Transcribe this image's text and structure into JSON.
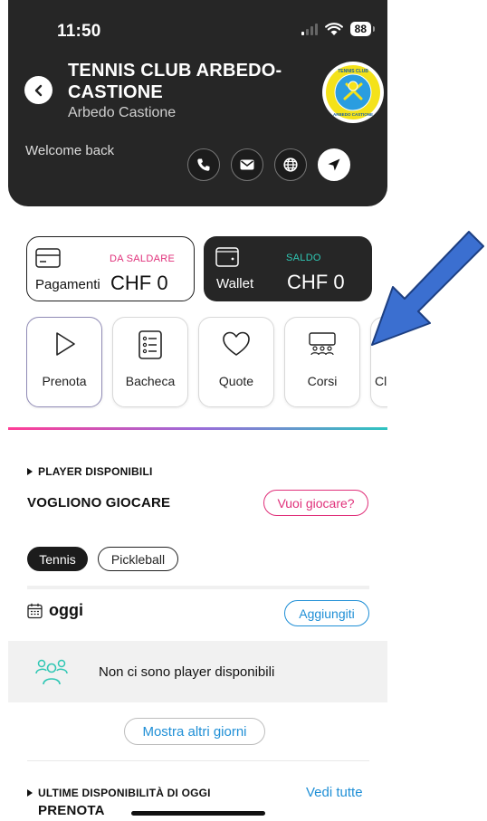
{
  "status_bar": {
    "time": "11:50",
    "battery": "88",
    "icons": [
      "signal-icon",
      "wifi-icon",
      "battery-icon"
    ]
  },
  "header": {
    "club_name": "TENNIS CLUB ARBEDO-CASTIONE",
    "club_city": "Arbedo Castione",
    "welcome": "Welcome back",
    "logo_text": "TENNIS CLUB ARBEDO CASTIONE",
    "contact_icons": [
      "phone-icon",
      "mail-icon",
      "globe-icon",
      "navigation-icon"
    ]
  },
  "payments": {
    "pay": {
      "tag": "DA SALDARE",
      "label": "Pagamenti",
      "amount": "CHF 0"
    },
    "wallet": {
      "tag": "SALDO",
      "label": "Wallet",
      "amount": "CHF 0"
    }
  },
  "actions": [
    {
      "label": "Prenota",
      "icon": "play-icon"
    },
    {
      "label": "Bacheca",
      "icon": "list-icon"
    },
    {
      "label": "Quote",
      "icon": "heart-icon"
    },
    {
      "label": "Corsi",
      "icon": "classroom-icon"
    },
    {
      "label": "Cl",
      "icon": ""
    }
  ],
  "players": {
    "section_label": "PLAYER DISPONIBILI",
    "title": "VOGLIONO GIOCARE",
    "want_to_play": "Vuoi giocare?",
    "sports": [
      "Tennis",
      "Pickleball"
    ],
    "today": "oggi",
    "add_me": "Aggiungiti",
    "empty": "Non ci sono player disponibili",
    "more_days": "Mostra altri giorni"
  },
  "last_availability": {
    "section_label": "ULTIME DISPONIBILITÀ DI OGGI",
    "see_all": "Vedi tutte",
    "title": "PRENOTA"
  },
  "colors": {
    "header_bg": "#262626",
    "accent_pink": "#e0307a",
    "accent_teal": "#2fc7b4",
    "link_blue": "#1f8fd6",
    "arrow_blue": "#3b6fd0"
  }
}
